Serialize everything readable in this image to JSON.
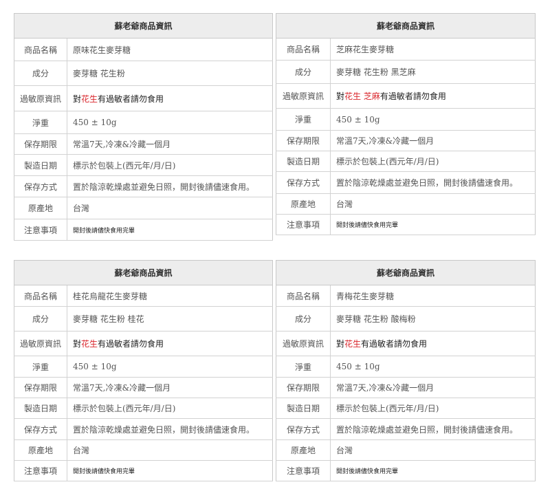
{
  "tables": [
    {
      "title": "蘇老爺商品資訊",
      "rows": {
        "name": {
          "label": "商品名稱",
          "value": "原味花生麥芽糖"
        },
        "ingredients": {
          "label": "成分",
          "value": "麥芽糖 花生粉"
        },
        "allergen": {
          "label": "過敏原資訊",
          "prefix": "對",
          "allergens": "花生",
          "suffix": "有過敏者請勿食用"
        },
        "weight": {
          "label": "淨重",
          "value": "450 ± 10g"
        },
        "shelf_life": {
          "label": "保存期限",
          "value": "常溫7天,冷凍&冷藏一個月"
        },
        "mfg_date": {
          "label": "製造日期",
          "value": "標示於包裝上(西元年/月/日)"
        },
        "storage": {
          "label": "保存方式",
          "value": "置於陰涼乾燥處並避免日照，開封後請儘速食用。"
        },
        "origin": {
          "label": "原產地",
          "value": "台灣"
        },
        "notes": {
          "label": "注意事項",
          "value": "開封後請儘快食用完畢"
        }
      }
    },
    {
      "title": "蘇老爺商品資訊",
      "rows": {
        "name": {
          "label": "商品名稱",
          "value": "芝麻花生麥芽糖"
        },
        "ingredients": {
          "label": "成分",
          "value": "麥芽糖 花生粉 黑芝麻"
        },
        "allergen": {
          "label": "過敏原資訊",
          "prefix": "對",
          "allergens": "花生 芝麻",
          "suffix": "有過敏者請勿食用"
        },
        "weight": {
          "label": "淨重",
          "value": "450 ± 10g"
        },
        "shelf_life": {
          "label": "保存期限",
          "value": "常溫7天,冷凍&冷藏一個月"
        },
        "mfg_date": {
          "label": "製造日期",
          "value": "標示於包裝上(西元年/月/日)"
        },
        "storage": {
          "label": "保存方式",
          "value": "置於陰涼乾燥處並避免日照，開封後請儘速食用。"
        },
        "origin": {
          "label": "原產地",
          "value": "台灣"
        },
        "notes": {
          "label": "注意事項",
          "value": "開封後請儘快食用完畢"
        }
      }
    },
    {
      "title": "蘇老爺商品資訊",
      "rows": {
        "name": {
          "label": "商品名稱",
          "value": "桂花烏龍花生麥芽糖"
        },
        "ingredients": {
          "label": "成分",
          "value": "麥芽糖 花生粉 桂花"
        },
        "allergen": {
          "label": "過敏原資訊",
          "prefix": "對",
          "allergens": "花生",
          "suffix": "有過敏者請勿食用"
        },
        "weight": {
          "label": "淨重",
          "value": "450 ± 10g"
        },
        "shelf_life": {
          "label": "保存期限",
          "value": "常溫7天,冷凍&冷藏一個月"
        },
        "mfg_date": {
          "label": "製造日期",
          "value": "標示於包裝上(西元年/月/日)"
        },
        "storage": {
          "label": "保存方式",
          "value": "置於陰涼乾燥處並避免日照，開封後請儘速食用。"
        },
        "origin": {
          "label": "原產地",
          "value": "台灣"
        },
        "notes": {
          "label": "注意事項",
          "value": "開封後請儘快食用完畢"
        }
      }
    },
    {
      "title": "蘇老爺商品資訊",
      "rows": {
        "name": {
          "label": "商品名稱",
          "value": "青梅花生麥芽糖"
        },
        "ingredients": {
          "label": "成分",
          "value": "麥芽糖 花生粉 酸梅粉"
        },
        "allergen": {
          "label": "過敏原資訊",
          "prefix": "對",
          "allergens": "花生",
          "suffix": "有過敏者請勿食用"
        },
        "weight": {
          "label": "淨重",
          "value": "450 ± 10g"
        },
        "shelf_life": {
          "label": "保存期限",
          "value": "常溫7天,冷凍&冷藏一個月"
        },
        "mfg_date": {
          "label": "製造日期",
          "value": "標示於包裝上(西元年/月/日)"
        },
        "storage": {
          "label": "保存方式",
          "value": "置於陰涼乾燥處並避免日照，開封後請儘速食用。"
        },
        "origin": {
          "label": "原產地",
          "value": "台灣"
        },
        "notes": {
          "label": "注意事項",
          "value": "開封後請儘快食用完畢"
        }
      }
    }
  ],
  "colors": {
    "allergen_highlight": "#d9252b",
    "header_bg": "#ededed",
    "border": "#d2d2d2"
  }
}
